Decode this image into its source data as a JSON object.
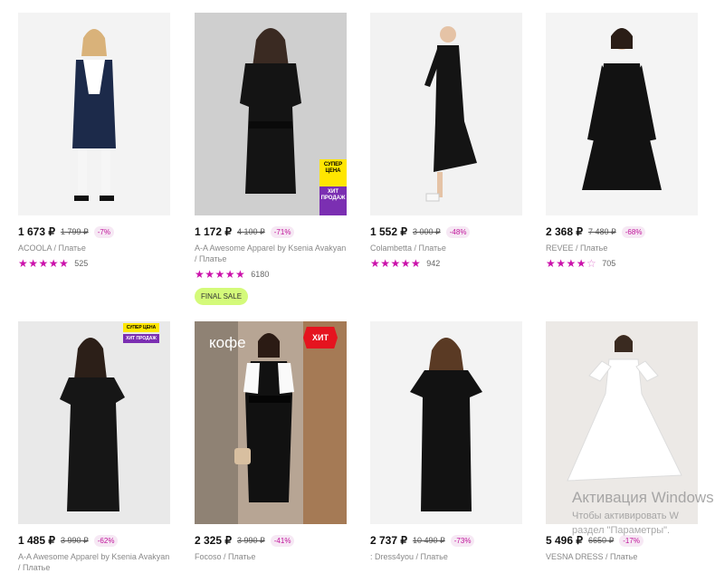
{
  "products": [
    {
      "price": "1 673 ₽",
      "old_price": "1 799 ₽",
      "discount": "-7%",
      "brand": "ACOOLA / Платье",
      "stars": 5,
      "reviews": "525"
    },
    {
      "price": "1 172 ₽",
      "old_price": "4 100 ₽",
      "discount": "-71%",
      "brand": "A-A Awesome Apparel by Ksenia Avakyan / Платье",
      "stars": 5,
      "reviews": "6180",
      "tag": "FINAL SALE",
      "badge_top": "СУПЕР ЦЕНА",
      "badge_bottom": "ХИТ ПРОДАЖ"
    },
    {
      "price": "1 552 ₽",
      "old_price": "3 000 ₽",
      "discount": "-48%",
      "brand": "Colambetta / Платье",
      "stars": 5,
      "reviews": "942"
    },
    {
      "price": "2 368 ₽",
      "old_price": "7 480 ₽",
      "discount": "-68%",
      "brand": "REVEE / Платье",
      "stars": 4,
      "reviews": "705"
    },
    {
      "price": "1 485 ₽",
      "old_price": "3 990 ₽",
      "discount": "-62%",
      "brand": "A-A Awesome Apparel by Ksenia Avakyan / Платье",
      "badge_top": "СУПЕР ЦЕНА",
      "badge_bottom": "ХИТ ПРОДАЖ"
    },
    {
      "price": "2 325 ₽",
      "old_price": "3 990 ₽",
      "discount": "-41%",
      "brand": "Focoso / Платье",
      "hit": "ХИТ",
      "photo_text": "кофе"
    },
    {
      "price": "2 737 ₽",
      "old_price": "10 490 ₽",
      "discount": "-73%",
      "brand": ": Dress4you / Платье"
    },
    {
      "price": "5 496 ₽",
      "old_price": "6650 ₽",
      "discount": "-17%",
      "brand": "VESNA DRESS / Платье"
    }
  ],
  "watermark": {
    "line1": "Активация Windows",
    "line2": "Чтобы активировать W",
    "line3": "раздел \"Параметры\"."
  },
  "colors": {
    "accent": "#cb11ab",
    "final_sale_bg": "#d4fa7a",
    "hit_badge": "#e5141f"
  }
}
